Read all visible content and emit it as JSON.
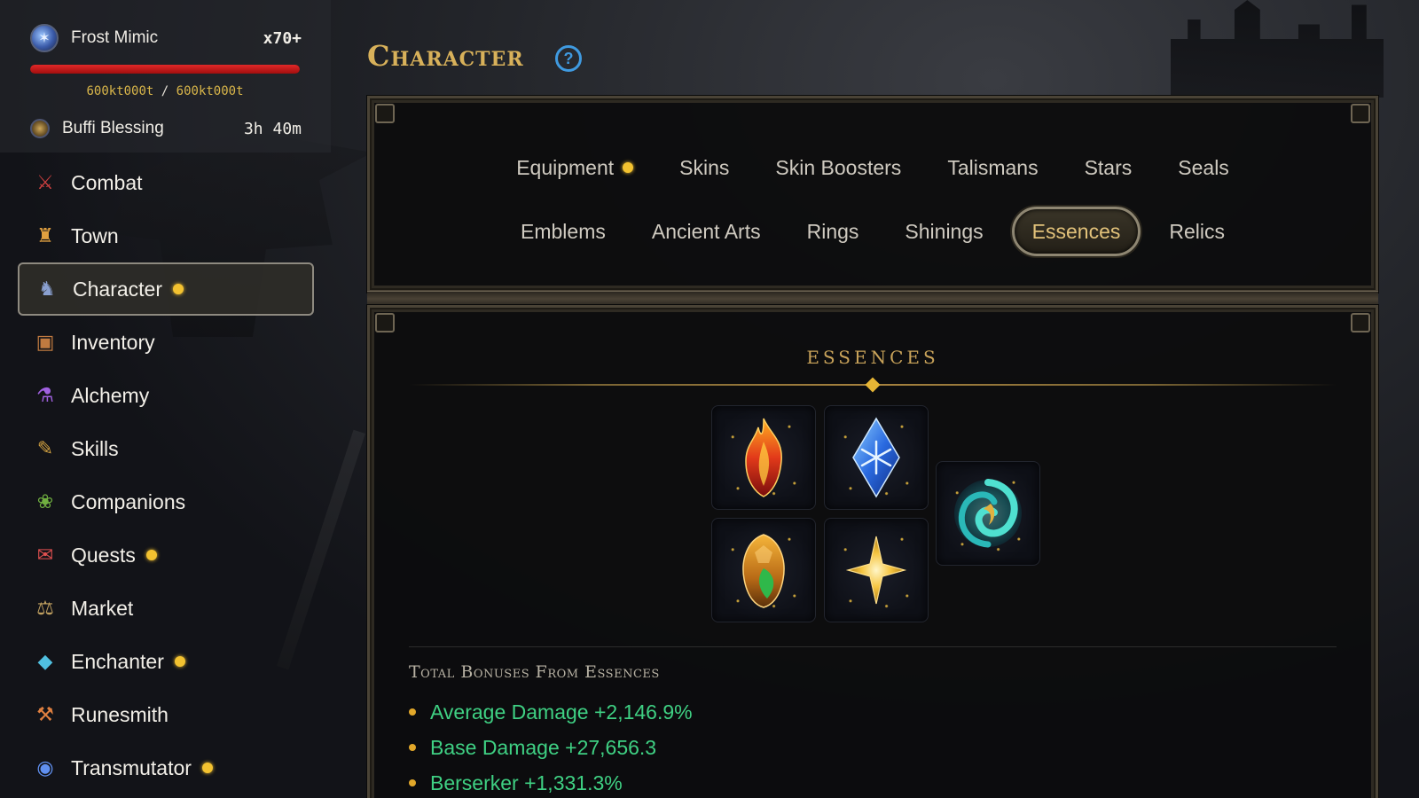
{
  "player_status": {
    "pet_name": "Frost Mimic",
    "pet_multiplier": "x70+",
    "hp_current": "600kt000t",
    "hp_separator": "/",
    "hp_max": "600kt000t",
    "hp_fraction": 1.0,
    "buff_name": "Buffi Blessing",
    "buff_time": "3h 40m"
  },
  "sidebar": {
    "items": [
      {
        "label": "Combat",
        "icon": "crossed-swords-icon",
        "dot": false
      },
      {
        "label": "Town",
        "icon": "castle-icon",
        "dot": false
      },
      {
        "label": "Character",
        "icon": "knight-icon",
        "dot": true,
        "active": true
      },
      {
        "label": "Inventory",
        "icon": "backpack-icon",
        "dot": false
      },
      {
        "label": "Alchemy",
        "icon": "potion-icon",
        "dot": false
      },
      {
        "label": "Skills",
        "icon": "spellbook-icon",
        "dot": false
      },
      {
        "label": "Companions",
        "icon": "paw-icon",
        "dot": false
      },
      {
        "label": "Quests",
        "icon": "scroll-icon",
        "dot": true
      },
      {
        "label": "Market",
        "icon": "scales-icon",
        "dot": false
      },
      {
        "label": "Enchanter",
        "icon": "crystal-icon",
        "dot": true
      },
      {
        "label": "Runesmith",
        "icon": "hammer-icon",
        "dot": false
      },
      {
        "label": "Transmutator",
        "icon": "swirl-orb-icon",
        "dot": true
      }
    ]
  },
  "page": {
    "title": "Character",
    "help_label": "?"
  },
  "tabs": {
    "row1": [
      {
        "label": "Equipment",
        "dot": true
      },
      {
        "label": "Skins"
      },
      {
        "label": "Skin Boosters"
      },
      {
        "label": "Talismans"
      },
      {
        "label": "Stars"
      },
      {
        "label": "Seals"
      }
    ],
    "row2": [
      {
        "label": "Emblems"
      },
      {
        "label": "Ancient Arts"
      },
      {
        "label": "Rings"
      },
      {
        "label": "Shinings"
      },
      {
        "label": "Essences",
        "active": true
      },
      {
        "label": "Relics"
      }
    ]
  },
  "essences": {
    "section_title": "ESSENCES",
    "slots": [
      {
        "name": "fire-essence",
        "icon": "fire-crystal-icon"
      },
      {
        "name": "frost-essence",
        "icon": "ice-crystal-icon"
      },
      {
        "name": "nature-essence",
        "icon": "nature-crystal-icon"
      },
      {
        "name": "light-essence",
        "icon": "star-icon"
      },
      {
        "name": "wind-essence",
        "icon": "wind-swirl-icon"
      }
    ],
    "bonus_title": "Total Bonuses From Essences",
    "bonuses": [
      "Average Damage +2,146.9%",
      "Base Damage +27,656.3",
      "Berserker +1,331.3%"
    ]
  },
  "colors": {
    "gold_accent": "#d8b15a",
    "bonus_green": "#3fd083",
    "notify_dot": "#f3c230",
    "hp_red": "#e02828",
    "help_blue": "#3f9ae0"
  }
}
